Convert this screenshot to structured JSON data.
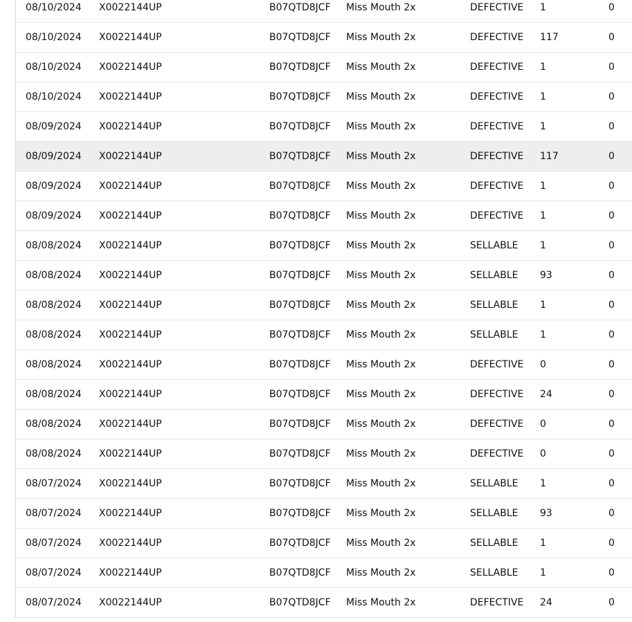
{
  "table": {
    "rows": [
      {
        "date": "08/10/2024",
        "fnsku": "X0022144UP",
        "asin": "B07QTD8JCF",
        "title": "Miss Mouth 2x",
        "disposition": "DEFECTIVE",
        "quantity": "1",
        "last": "0"
      },
      {
        "date": "08/10/2024",
        "fnsku": "X0022144UP",
        "asin": "B07QTD8JCF",
        "title": "Miss Mouth 2x",
        "disposition": "DEFECTIVE",
        "quantity": "117",
        "last": "0"
      },
      {
        "date": "08/10/2024",
        "fnsku": "X0022144UP",
        "asin": "B07QTD8JCF",
        "title": "Miss Mouth 2x",
        "disposition": "DEFECTIVE",
        "quantity": "1",
        "last": "0"
      },
      {
        "date": "08/10/2024",
        "fnsku": "X0022144UP",
        "asin": "B07QTD8JCF",
        "title": "Miss Mouth 2x",
        "disposition": "DEFECTIVE",
        "quantity": "1",
        "last": "0"
      },
      {
        "date": "08/09/2024",
        "fnsku": "X0022144UP",
        "asin": "B07QTD8JCF",
        "title": "Miss Mouth 2x",
        "disposition": "DEFECTIVE",
        "quantity": "1",
        "last": "0"
      },
      {
        "date": "08/09/2024",
        "fnsku": "X0022144UP",
        "asin": "B07QTD8JCF",
        "title": "Miss Mouth 2x",
        "disposition": "DEFECTIVE",
        "quantity": "117",
        "last": "0",
        "highlighted": true
      },
      {
        "date": "08/09/2024",
        "fnsku": "X0022144UP",
        "asin": "B07QTD8JCF",
        "title": "Miss Mouth 2x",
        "disposition": "DEFECTIVE",
        "quantity": "1",
        "last": "0"
      },
      {
        "date": "08/09/2024",
        "fnsku": "X0022144UP",
        "asin": "B07QTD8JCF",
        "title": "Miss Mouth 2x",
        "disposition": "DEFECTIVE",
        "quantity": "1",
        "last": "0"
      },
      {
        "date": "08/08/2024",
        "fnsku": "X0022144UP",
        "asin": "B07QTD8JCF",
        "title": "Miss Mouth 2x",
        "disposition": "SELLABLE",
        "quantity": "1",
        "last": "0"
      },
      {
        "date": "08/08/2024",
        "fnsku": "X0022144UP",
        "asin": "B07QTD8JCF",
        "title": "Miss Mouth 2x",
        "disposition": "SELLABLE",
        "quantity": "93",
        "last": "0"
      },
      {
        "date": "08/08/2024",
        "fnsku": "X0022144UP",
        "asin": "B07QTD8JCF",
        "title": "Miss Mouth 2x",
        "disposition": "SELLABLE",
        "quantity": "1",
        "last": "0"
      },
      {
        "date": "08/08/2024",
        "fnsku": "X0022144UP",
        "asin": "B07QTD8JCF",
        "title": "Miss Mouth 2x",
        "disposition": "SELLABLE",
        "quantity": "1",
        "last": "0"
      },
      {
        "date": "08/08/2024",
        "fnsku": "X0022144UP",
        "asin": "B07QTD8JCF",
        "title": "Miss Mouth 2x",
        "disposition": "DEFECTIVE",
        "quantity": "0",
        "last": "0"
      },
      {
        "date": "08/08/2024",
        "fnsku": "X0022144UP",
        "asin": "B07QTD8JCF",
        "title": "Miss Mouth 2x",
        "disposition": "DEFECTIVE",
        "quantity": "24",
        "last": "0"
      },
      {
        "date": "08/08/2024",
        "fnsku": "X0022144UP",
        "asin": "B07QTD8JCF",
        "title": "Miss Mouth 2x",
        "disposition": "DEFECTIVE",
        "quantity": "0",
        "last": "0"
      },
      {
        "date": "08/08/2024",
        "fnsku": "X0022144UP",
        "asin": "B07QTD8JCF",
        "title": "Miss Mouth 2x",
        "disposition": "DEFECTIVE",
        "quantity": "0",
        "last": "0"
      },
      {
        "date": "08/07/2024",
        "fnsku": "X0022144UP",
        "asin": "B07QTD8JCF",
        "title": "Miss Mouth 2x",
        "disposition": "SELLABLE",
        "quantity": "1",
        "last": "0"
      },
      {
        "date": "08/07/2024",
        "fnsku": "X0022144UP",
        "asin": "B07QTD8JCF",
        "title": "Miss Mouth 2x",
        "disposition": "SELLABLE",
        "quantity": "93",
        "last": "0"
      },
      {
        "date": "08/07/2024",
        "fnsku": "X0022144UP",
        "asin": "B07QTD8JCF",
        "title": "Miss Mouth 2x",
        "disposition": "SELLABLE",
        "quantity": "1",
        "last": "0"
      },
      {
        "date": "08/07/2024",
        "fnsku": "X0022144UP",
        "asin": "B07QTD8JCF",
        "title": "Miss Mouth 2x",
        "disposition": "SELLABLE",
        "quantity": "1",
        "last": "0"
      },
      {
        "date": "08/07/2024",
        "fnsku": "X0022144UP",
        "asin": "B07QTD8JCF",
        "title": "Miss Mouth 2x",
        "disposition": "DEFECTIVE",
        "quantity": "24",
        "last": "0"
      }
    ]
  }
}
